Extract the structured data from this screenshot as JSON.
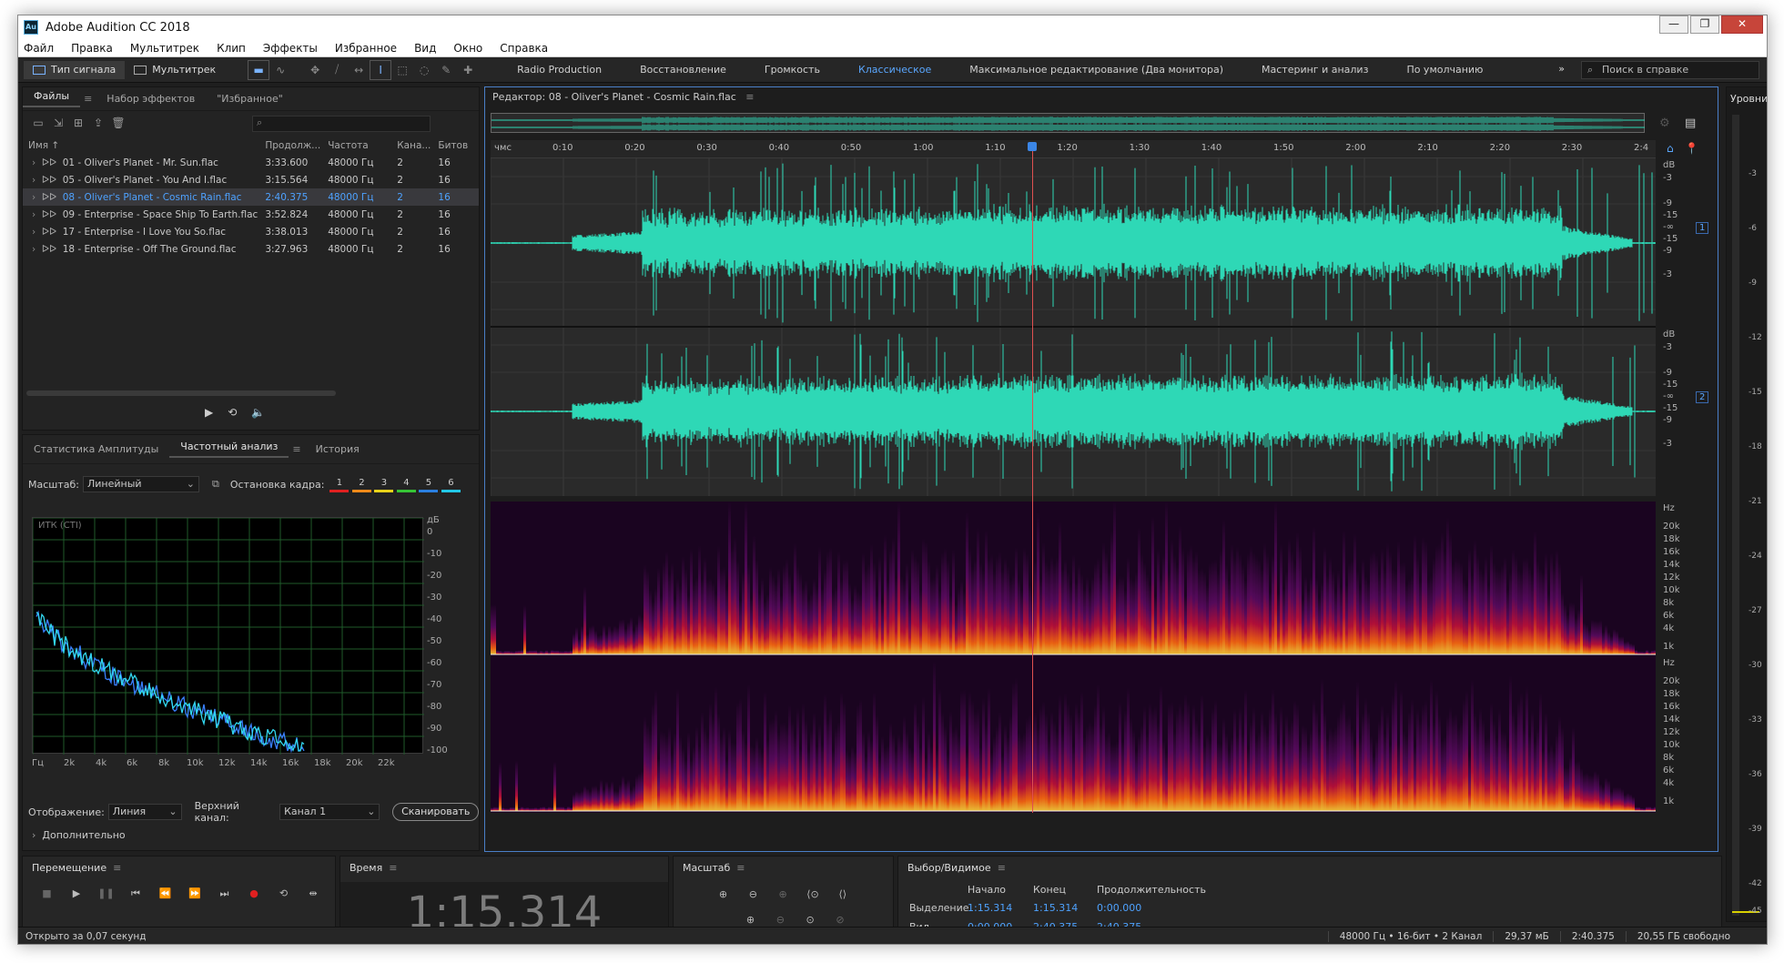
{
  "window": {
    "title": "Adobe Audition CC 2018",
    "icon_label": "Au"
  },
  "menu": [
    "Файл",
    "Правка",
    "Мультитрек",
    "Клип",
    "Эффекты",
    "Избранное",
    "Вид",
    "Окно",
    "Справка"
  ],
  "toolbar": {
    "mode_waveform": "Тип сигнала",
    "mode_multitrack": "Мультитрек",
    "workspaces": [
      "Radio Production",
      "Восстановление",
      "Громкость",
      "Классическое",
      "Максимальное редактирование (Два монитора)",
      "Мастеринг и анализ",
      "По умолчанию"
    ],
    "active_workspace": "Классическое",
    "more": "»",
    "help_placeholder": "Поиск в справке"
  },
  "files_panel": {
    "tabs": [
      "Файлы",
      "Набор эффектов",
      "\"Избранное\""
    ],
    "columns": [
      "Имя",
      "Продолж...",
      "Частота",
      "Кана...",
      "Битов"
    ],
    "rows": [
      {
        "name": "01 - Oliver's Planet - Mr. Sun.flac",
        "duration": "3:33.600",
        "rate": "48000 Гц",
        "channels": "2",
        "bits": "16",
        "selected": false
      },
      {
        "name": "05 - Oliver's Planet - You And I.flac",
        "duration": "3:15.564",
        "rate": "48000 Гц",
        "channels": "2",
        "bits": "16",
        "selected": false
      },
      {
        "name": "08 - Oliver's Planet - Cosmic Rain.flac",
        "duration": "2:40.375",
        "rate": "48000 Гц",
        "channels": "2",
        "bits": "16",
        "selected": true
      },
      {
        "name": "09 - Enterprise - Space Ship To Earth.flac",
        "duration": "3:52.824",
        "rate": "48000 Гц",
        "channels": "2",
        "bits": "16",
        "selected": false
      },
      {
        "name": "17 - Enterprise - I Love You So.flac",
        "duration": "3:38.013",
        "rate": "48000 Гц",
        "channels": "2",
        "bits": "16",
        "selected": false
      },
      {
        "name": "18 - Enterprise - Off The Ground.flac",
        "duration": "3:27.963",
        "rate": "48000 Гц",
        "channels": "2",
        "bits": "16",
        "selected": false
      }
    ]
  },
  "analysis_panel": {
    "tabs": [
      "Статистика Амплитуды",
      "Частотный анализ",
      "История"
    ],
    "scale_label": "Масштаб:",
    "scale_value": "Линейный",
    "freeze_label": "Остановка кадра:",
    "frames": [
      {
        "n": "1",
        "color": "#e02020"
      },
      {
        "n": "2",
        "color": "#f08a1a"
      },
      {
        "n": "3",
        "color": "#e8d21a"
      },
      {
        "n": "4",
        "color": "#36c436"
      },
      {
        "n": "5",
        "color": "#2a7fe0"
      },
      {
        "n": "6",
        "color": "#22c8e8"
      }
    ],
    "graph_label": "ИТК (СТI)",
    "db_unit": "дБ",
    "db_ticks": [
      "0",
      "-10",
      "-20",
      "-30",
      "-40",
      "-50",
      "-60",
      "-70",
      "-80",
      "-90",
      "-100"
    ],
    "hz_ticks": [
      "Гц",
      "2k",
      "4k",
      "6k",
      "8k",
      "10k",
      "12k",
      "14k",
      "16k",
      "18k",
      "20k",
      "22k"
    ],
    "display_label": "Отображение:",
    "display_value": "Линия",
    "channel_label": "Верхний канал:",
    "channel_value": "Канал 1",
    "scan_button": "Сканировать",
    "more_label": "Дополнительно"
  },
  "editor": {
    "title": "Редактор: 08 - Oliver's Planet - Cosmic Rain.flac",
    "ruler_unit": "чмс",
    "ruler_ticks": [
      "0:10",
      "0:20",
      "0:30",
      "0:40",
      "0:50",
      "1:00",
      "1:10",
      "1:20",
      "1:30",
      "1:40",
      "1:50",
      "2:00",
      "2:10",
      "2:20",
      "2:30",
      "2:4"
    ],
    "wave_db_ticks": [
      "dB",
      "-3",
      "-6",
      "-9",
      "-15",
      "-∞",
      "-15",
      "-9",
      "-6",
      "-3"
    ],
    "spec_hz_ticks": [
      "Hz",
      "20k",
      "18k",
      "16k",
      "14k",
      "12k",
      "10k",
      "8k",
      "6k",
      "4k",
      "1k"
    ],
    "channel_1": "1",
    "channel_2": "2",
    "waveform_color": "#2ed8b6",
    "playhead_fraction": 0.465
  },
  "levels": {
    "title": "Уровни",
    "ticks": [
      "-3",
      "-6",
      "-9",
      "-12",
      "-15",
      "-18",
      "-21",
      "-24",
      "-27",
      "-30",
      "-33",
      "-36",
      "-39",
      "-42",
      "-45"
    ]
  },
  "transport": {
    "title": "Перемещение"
  },
  "time": {
    "title": "Время",
    "value": "1:15.314"
  },
  "zoom": {
    "title": "Масштаб"
  },
  "selection": {
    "title": "Выбор/Видимое",
    "col_start": "Начало",
    "col_end": "Конец",
    "col_duration": "Продолжительность",
    "row_selection": "Выделение",
    "row_view": "Вид",
    "sel_start": "1:15.314",
    "sel_end": "1:15.314",
    "sel_dur": "0:00.000",
    "view_start": "0:00.000",
    "view_end": "2:40.375",
    "view_dur": "2:40.375"
  },
  "status": {
    "left": "Открыто за 0,07 секунд",
    "format": "48000 Гц • 16-бит • 2 Канал",
    "size": "29,37 мБ",
    "duration": "2:40.375",
    "free": "20,55 ГБ свободно"
  }
}
